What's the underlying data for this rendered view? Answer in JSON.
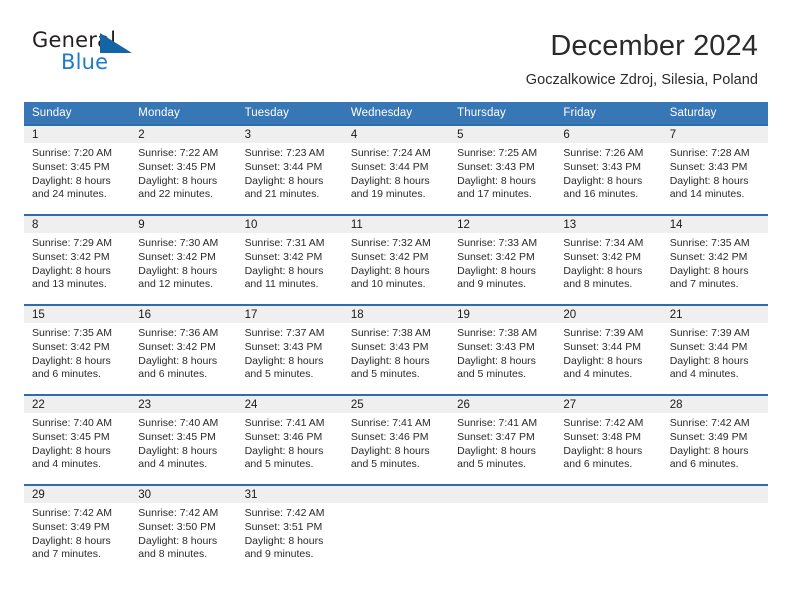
{
  "logo": {
    "word_general": "General",
    "word_blue": "Blue",
    "triangle_color": "#1565a6",
    "blue_color": "#1e7cc4"
  },
  "header": {
    "month_title": "December 2024",
    "location": "Goczalkowice Zdroj, Silesia, Poland"
  },
  "theme": {
    "header_bg": "#3877b5",
    "row_divider": "#2f6da8",
    "daynum_bg": "#efefef"
  },
  "weekday_headers": [
    "Sunday",
    "Monday",
    "Tuesday",
    "Wednesday",
    "Thursday",
    "Friday",
    "Saturday"
  ],
  "weeks": [
    [
      {
        "day": "1",
        "sunrise": "Sunrise: 7:20 AM",
        "sunset": "Sunset: 3:45 PM",
        "daylight": "Daylight: 8 hours and 24 minutes."
      },
      {
        "day": "2",
        "sunrise": "Sunrise: 7:22 AM",
        "sunset": "Sunset: 3:45 PM",
        "daylight": "Daylight: 8 hours and 22 minutes."
      },
      {
        "day": "3",
        "sunrise": "Sunrise: 7:23 AM",
        "sunset": "Sunset: 3:44 PM",
        "daylight": "Daylight: 8 hours and 21 minutes."
      },
      {
        "day": "4",
        "sunrise": "Sunrise: 7:24 AM",
        "sunset": "Sunset: 3:44 PM",
        "daylight": "Daylight: 8 hours and 19 minutes."
      },
      {
        "day": "5",
        "sunrise": "Sunrise: 7:25 AM",
        "sunset": "Sunset: 3:43 PM",
        "daylight": "Daylight: 8 hours and 17 minutes."
      },
      {
        "day": "6",
        "sunrise": "Sunrise: 7:26 AM",
        "sunset": "Sunset: 3:43 PM",
        "daylight": "Daylight: 8 hours and 16 minutes."
      },
      {
        "day": "7",
        "sunrise": "Sunrise: 7:28 AM",
        "sunset": "Sunset: 3:43 PM",
        "daylight": "Daylight: 8 hours and 14 minutes."
      }
    ],
    [
      {
        "day": "8",
        "sunrise": "Sunrise: 7:29 AM",
        "sunset": "Sunset: 3:42 PM",
        "daylight": "Daylight: 8 hours and 13 minutes."
      },
      {
        "day": "9",
        "sunrise": "Sunrise: 7:30 AM",
        "sunset": "Sunset: 3:42 PM",
        "daylight": "Daylight: 8 hours and 12 minutes."
      },
      {
        "day": "10",
        "sunrise": "Sunrise: 7:31 AM",
        "sunset": "Sunset: 3:42 PM",
        "daylight": "Daylight: 8 hours and 11 minutes."
      },
      {
        "day": "11",
        "sunrise": "Sunrise: 7:32 AM",
        "sunset": "Sunset: 3:42 PM",
        "daylight": "Daylight: 8 hours and 10 minutes."
      },
      {
        "day": "12",
        "sunrise": "Sunrise: 7:33 AM",
        "sunset": "Sunset: 3:42 PM",
        "daylight": "Daylight: 8 hours and 9 minutes."
      },
      {
        "day": "13",
        "sunrise": "Sunrise: 7:34 AM",
        "sunset": "Sunset: 3:42 PM",
        "daylight": "Daylight: 8 hours and 8 minutes."
      },
      {
        "day": "14",
        "sunrise": "Sunrise: 7:35 AM",
        "sunset": "Sunset: 3:42 PM",
        "daylight": "Daylight: 8 hours and 7 minutes."
      }
    ],
    [
      {
        "day": "15",
        "sunrise": "Sunrise: 7:35 AM",
        "sunset": "Sunset: 3:42 PM",
        "daylight": "Daylight: 8 hours and 6 minutes."
      },
      {
        "day": "16",
        "sunrise": "Sunrise: 7:36 AM",
        "sunset": "Sunset: 3:42 PM",
        "daylight": "Daylight: 8 hours and 6 minutes."
      },
      {
        "day": "17",
        "sunrise": "Sunrise: 7:37 AM",
        "sunset": "Sunset: 3:43 PM",
        "daylight": "Daylight: 8 hours and 5 minutes."
      },
      {
        "day": "18",
        "sunrise": "Sunrise: 7:38 AM",
        "sunset": "Sunset: 3:43 PM",
        "daylight": "Daylight: 8 hours and 5 minutes."
      },
      {
        "day": "19",
        "sunrise": "Sunrise: 7:38 AM",
        "sunset": "Sunset: 3:43 PM",
        "daylight": "Daylight: 8 hours and 5 minutes."
      },
      {
        "day": "20",
        "sunrise": "Sunrise: 7:39 AM",
        "sunset": "Sunset: 3:44 PM",
        "daylight": "Daylight: 8 hours and 4 minutes."
      },
      {
        "day": "21",
        "sunrise": "Sunrise: 7:39 AM",
        "sunset": "Sunset: 3:44 PM",
        "daylight": "Daylight: 8 hours and 4 minutes."
      }
    ],
    [
      {
        "day": "22",
        "sunrise": "Sunrise: 7:40 AM",
        "sunset": "Sunset: 3:45 PM",
        "daylight": "Daylight: 8 hours and 4 minutes."
      },
      {
        "day": "23",
        "sunrise": "Sunrise: 7:40 AM",
        "sunset": "Sunset: 3:45 PM",
        "daylight": "Daylight: 8 hours and 4 minutes."
      },
      {
        "day": "24",
        "sunrise": "Sunrise: 7:41 AM",
        "sunset": "Sunset: 3:46 PM",
        "daylight": "Daylight: 8 hours and 5 minutes."
      },
      {
        "day": "25",
        "sunrise": "Sunrise: 7:41 AM",
        "sunset": "Sunset: 3:46 PM",
        "daylight": "Daylight: 8 hours and 5 minutes."
      },
      {
        "day": "26",
        "sunrise": "Sunrise: 7:41 AM",
        "sunset": "Sunset: 3:47 PM",
        "daylight": "Daylight: 8 hours and 5 minutes."
      },
      {
        "day": "27",
        "sunrise": "Sunrise: 7:42 AM",
        "sunset": "Sunset: 3:48 PM",
        "daylight": "Daylight: 8 hours and 6 minutes."
      },
      {
        "day": "28",
        "sunrise": "Sunrise: 7:42 AM",
        "sunset": "Sunset: 3:49 PM",
        "daylight": "Daylight: 8 hours and 6 minutes."
      }
    ],
    [
      {
        "day": "29",
        "sunrise": "Sunrise: 7:42 AM",
        "sunset": "Sunset: 3:49 PM",
        "daylight": "Daylight: 8 hours and 7 minutes."
      },
      {
        "day": "30",
        "sunrise": "Sunrise: 7:42 AM",
        "sunset": "Sunset: 3:50 PM",
        "daylight": "Daylight: 8 hours and 8 minutes."
      },
      {
        "day": "31",
        "sunrise": "Sunrise: 7:42 AM",
        "sunset": "Sunset: 3:51 PM",
        "daylight": "Daylight: 8 hours and 9 minutes."
      },
      {
        "day": "",
        "sunrise": "",
        "sunset": "",
        "daylight": ""
      },
      {
        "day": "",
        "sunrise": "",
        "sunset": "",
        "daylight": ""
      },
      {
        "day": "",
        "sunrise": "",
        "sunset": "",
        "daylight": ""
      },
      {
        "day": "",
        "sunrise": "",
        "sunset": "",
        "daylight": ""
      }
    ]
  ]
}
